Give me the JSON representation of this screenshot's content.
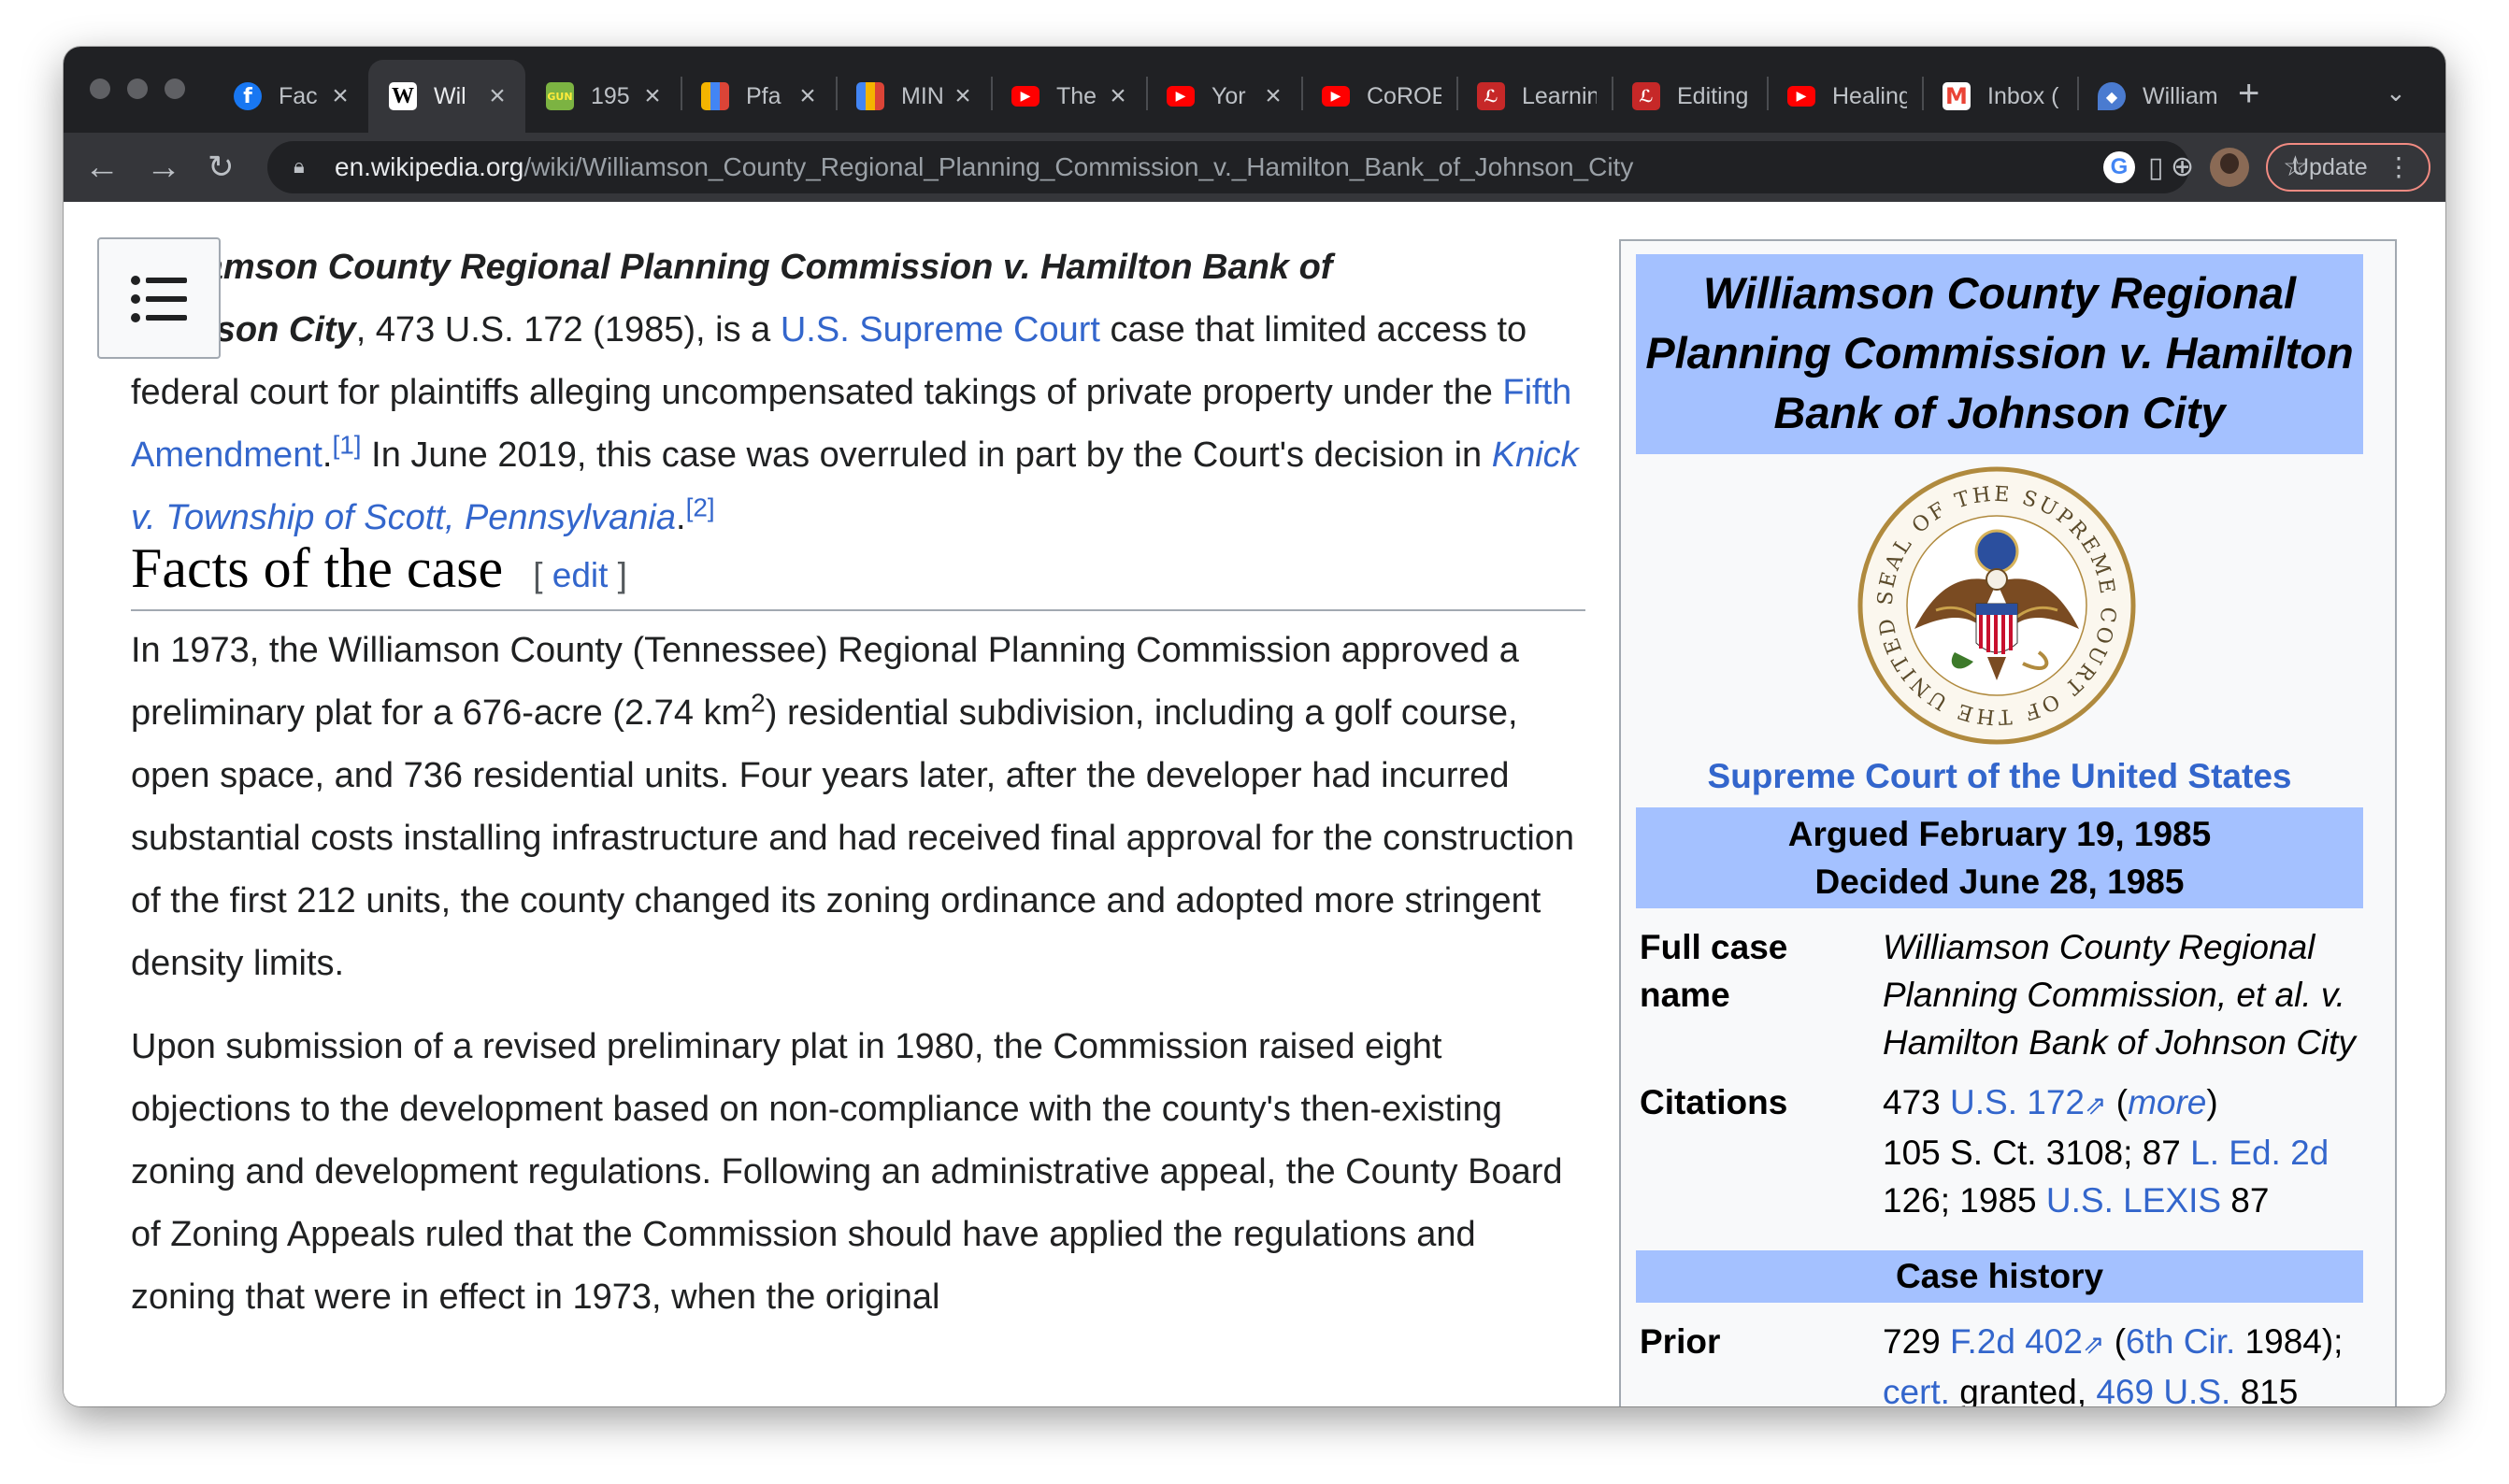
{
  "browser": {
    "tabs": [
      {
        "title": "Fac",
        "favicon": "facebook-icon",
        "color": "#1877f2"
      },
      {
        "title": "Wil",
        "favicon": "wikipedia-icon",
        "color": "#ffffff",
        "active": true
      },
      {
        "title": "195",
        "favicon": "gun-icon",
        "color": "#7cb342"
      },
      {
        "title": "Pfa",
        "favicon": "chart-icon",
        "color": "#f4b400"
      },
      {
        "title": "MIN",
        "favicon": "chart-icon",
        "color": "#4285f4"
      },
      {
        "title": "The",
        "favicon": "youtube-icon",
        "color": "#ff0000"
      },
      {
        "title": "Yor",
        "favicon": "youtube-icon",
        "color": "#ff0000"
      },
      {
        "title": "CoROE",
        "favicon": "youtube-icon",
        "color": "#ff0000"
      },
      {
        "title": "Learnin",
        "favicon": "learning-icon",
        "color": "#c62828"
      },
      {
        "title": "Editing",
        "favicon": "learning-icon",
        "color": "#c62828"
      },
      {
        "title": "Healing",
        "favicon": "youtube-icon",
        "color": "#ff0000"
      },
      {
        "title": "Inbox (",
        "favicon": "gmail-icon",
        "color": "#ea4335"
      },
      {
        "title": "William",
        "favicon": "shield-icon",
        "color": "#4a7bd0"
      }
    ],
    "address_host": "en.wikipedia.org",
    "address_path": "/wiki/Williamson_County_Regional_Planning_Commission_v._Hamilton_Bank_of_Johnson_City",
    "update_label": "Update"
  },
  "article": {
    "lead": {
      "title_top": "Williamson County Regional Planning Commission v. Hamilton Bank of",
      "title_bottom": "Johnson City",
      "t1": ", 473 U.S. 172 (1985), is a ",
      "link_court": "U.S. Supreme Court",
      "t2": " case that limited access to federal court for plaintiffs alleging uncompensated takings of private property under the ",
      "link_fifth": "Fifth Amendment",
      "ref1": "[1]",
      "t3": " In June 2019, this case was overruled in part by the Court's decision in ",
      "link_knick": "Knick v. Township of Scott, Pennsylvania",
      "ref2": "[2]"
    },
    "section_heading": "Facts of the case",
    "edit_link": "edit",
    "para1": {
      "a": "In 1973, the Williamson County (Tennessee) Regional Planning Commission approved a preliminary plat for a 676-acre (2.74 km",
      "sup": "2",
      "b": ") residential subdivision, including a golf course, open space, and 736 residential units. Four years later, after the developer had incurred substantial costs installing infrastructure and had received final approval for the construction of the first 212 units, the county changed its zoning ordinance and adopted more stringent density limits."
    },
    "para2": "Upon submission of a revised preliminary plat in 1980, the Commission raised eight objections to the development based on non-compliance with the county's then-existing zoning and development regulations. Following an administrative appeal, the County Board of Zoning Appeals ruled that the Commission should have applied the regulations and zoning that were in effect in 1973, when the original"
  },
  "infobox": {
    "title": "Williamson County Regional Planning Commission v. Hamilton Bank of Johnson City",
    "seal_text": "SEAL OF THE SUPREME COURT OF THE UNITED STATES",
    "caption": "Supreme Court of the United States",
    "argued": "Argued February 19, 1985",
    "decided": "Decided June 28, 1985",
    "full_case_name_label": "Full case name",
    "full_case_name": "Williamson County Regional Planning Commission, et al. v. Hamilton Bank of Johnson City",
    "citations_label": "Citations",
    "cit_473": "473 ",
    "cit_us172": "U.S. 172",
    "cit_paren_open": " (",
    "cit_more": "more",
    "cit_paren_close": ")",
    "cit_line2": "105 S. Ct. 3108; 87 ",
    "cit_led": "L. Ed. 2d",
    "cit_line3": "126; 1985 ",
    "cit_lexis": "U.S. LEXIS",
    "cit_87": " 87",
    "case_history": "Case history",
    "prior_label": "Prior",
    "prior_729": "729 ",
    "prior_f2d": "F.2d 402",
    "prior_sp": " (",
    "prior_6th": "6th Cir.",
    "prior_1984": " 1984);",
    "prior_cert": "cert.",
    "prior_granted": " granted, ",
    "prior_469": "469 U.S.",
    "prior_815": " 815"
  }
}
